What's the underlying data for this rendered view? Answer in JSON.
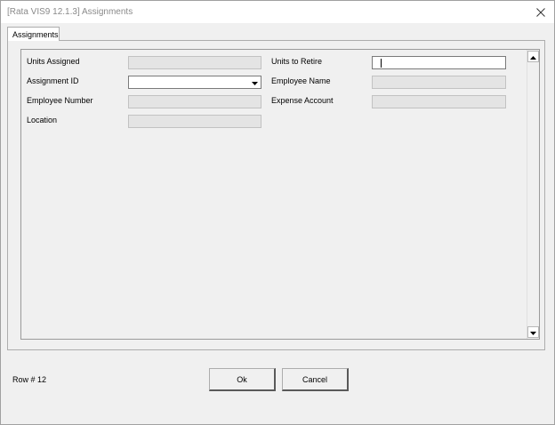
{
  "window": {
    "title": "[Rata VIS9 12.1.3] Assignments"
  },
  "tabs": [
    {
      "label": "Assignments",
      "selected": true
    }
  ],
  "form": {
    "units_assigned": {
      "label": "Units Assigned",
      "value": ""
    },
    "assignment_id": {
      "label": "Assignment ID",
      "value": ""
    },
    "employee_number": {
      "label": "Employee Number",
      "value": ""
    },
    "location": {
      "label": "Location",
      "value": ""
    },
    "units_to_retire": {
      "label": "Units to Retire",
      "value": ""
    },
    "employee_name": {
      "label": "Employee Name",
      "value": ""
    },
    "expense_account": {
      "label": "Expense Account",
      "value": ""
    }
  },
  "status": {
    "row_text": "Row # 12"
  },
  "buttons": {
    "ok_label": "Ok",
    "cancel_label": "Cancel"
  },
  "icons": {
    "close": "close-icon",
    "dropdown": "dropdown-arrow-icon",
    "scroll_up": "scroll-up-arrow-icon",
    "scroll_down": "scroll-down-arrow-icon"
  },
  "colors": {
    "window_bg": "#f0f0f0",
    "titlebar_bg": "#ffffff",
    "title_text": "#8a8a8a",
    "disabled_field": "#e4e4e4",
    "border": "#adadad"
  }
}
